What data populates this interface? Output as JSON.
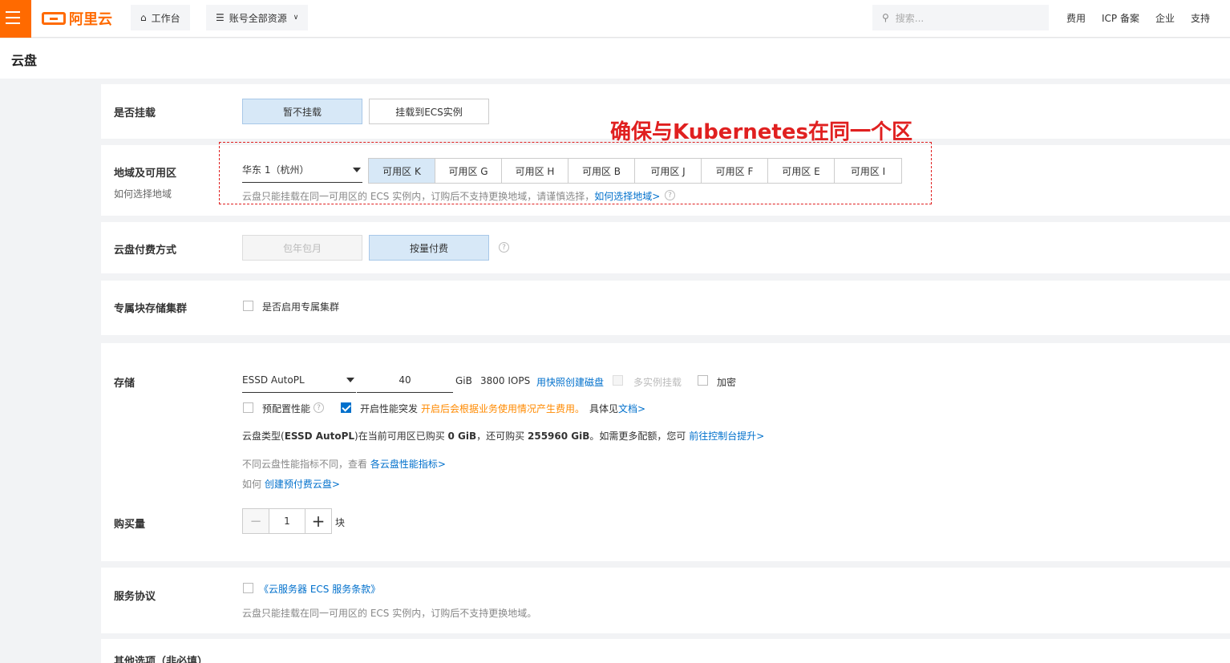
{
  "topbar": {
    "logo_text": "阿里云",
    "workbench": "工作台",
    "resources": "账号全部资源",
    "search_placeholder": "搜索...",
    "links": [
      "费用",
      "ICP 备案",
      "企业",
      "支持"
    ]
  },
  "page_title": "云盘",
  "annotation": "确保与Kubernetes在同一个区",
  "mount": {
    "label": "是否挂载",
    "options": [
      "暂不挂载",
      "挂载到ECS实例"
    ],
    "selected": "暂不挂载"
  },
  "region": {
    "label": "地域及可用区",
    "sublabel": "如何选择地域",
    "region_value": "华东 1（杭州）",
    "zones": [
      "可用区 K",
      "可用区 G",
      "可用区 H",
      "可用区 B",
      "可用区 J",
      "可用区 F",
      "可用区 E",
      "可用区 I"
    ],
    "selected_zone": "可用区 K",
    "hint": "云盘只能挂载在同一可用区的 ECS 实例内，订购后不支持更换地域，请谨慎选择，",
    "hint_link": "如何选择地域>"
  },
  "billing": {
    "label": "云盘付费方式",
    "options": [
      "包年包月",
      "按量付费"
    ],
    "selected": "按量付费"
  },
  "dedicated": {
    "label": "专属块存储集群",
    "checkbox_label": "是否启用专属集群"
  },
  "storage": {
    "label": "存储",
    "type": "ESSD AutoPL",
    "size": "40",
    "unit": "GiB",
    "iops": "3800 IOPS",
    "snapshot_link": "用快照创建磁盘",
    "multi_attach": "多实例挂载",
    "encrypt": "加密",
    "provisioned": "预配置性能",
    "burst": "开启性能突发",
    "burst_warn": "开启后会根据业务使用情况产生费用。",
    "burst_more": "具体见",
    "burst_doc": "文档>",
    "quota_pre": "云盘类型(",
    "quota_type": "ESSD AutoPL",
    "quota_mid1": ")在当前可用区已购买 ",
    "quota_bought": "0 GiB",
    "quota_mid2": "，还可购买 ",
    "quota_remain": "255960 GiB",
    "quota_mid3": "。如需更多配额，您可 ",
    "quota_link": "前往控制台提升>",
    "perf_text": "不同云盘性能指标不同，查看 ",
    "perf_link": "各云盘性能指标>",
    "howto_text": "如何 ",
    "howto_link": "创建预付费云盘>"
  },
  "quantity": {
    "label": "购买量",
    "minus": "−",
    "value": "1",
    "plus": "+",
    "unit": "块"
  },
  "agreement": {
    "label": "服务协议",
    "link": "《云服务器 ECS 服务条款》",
    "hint": "云盘只能挂载在同一可用区的 ECS 实例内，订购后不支持更换地域。"
  },
  "other": {
    "label": "其他选项（非必填）"
  },
  "colors": {
    "brand": "#ff6a00",
    "link": "#0070cc",
    "annotation": "#e02020",
    "warning": "#ff8a00"
  }
}
